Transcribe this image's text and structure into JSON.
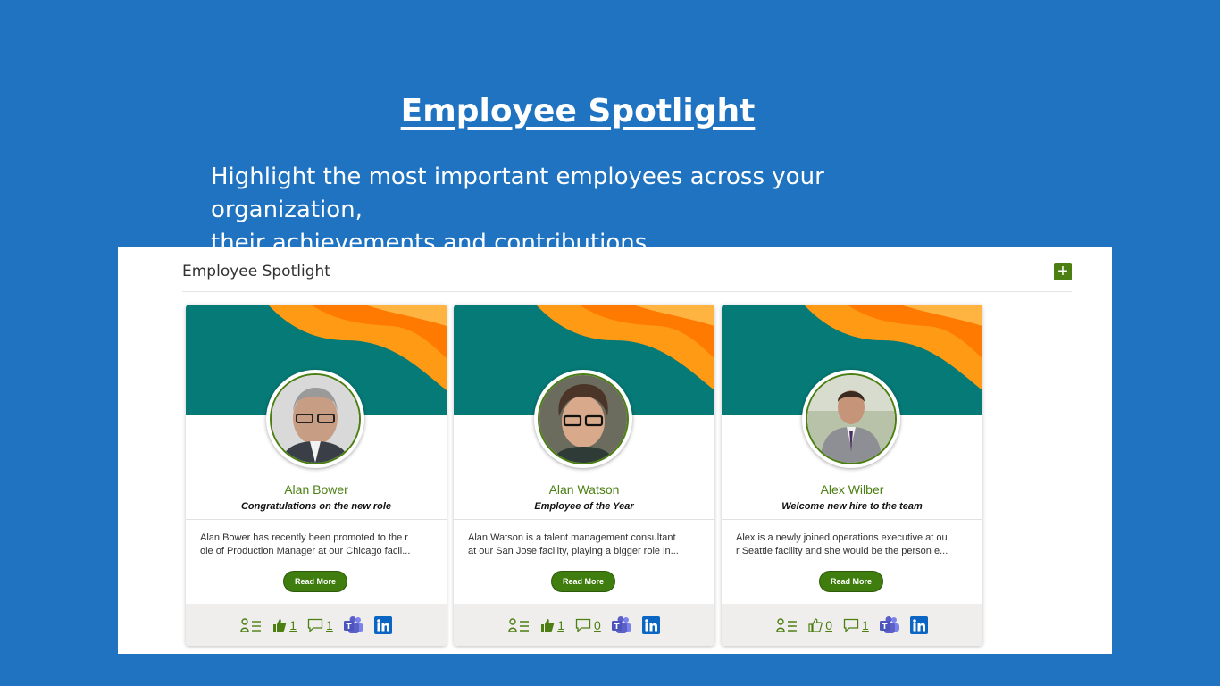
{
  "hero": {
    "title": "Employee Spotlight",
    "subtitle_line1": "Highlight the most important employees across your organization,",
    "subtitle_line2": "their achievements and contributions."
  },
  "panel": {
    "title": "Employee Spotlight",
    "add_label": "+"
  },
  "colors": {
    "page_bg": "#1f73c0",
    "accent_green": "#4b7f12",
    "banner_teal": "#067a76",
    "banner_orange": "#ff8a00",
    "teams_purple": "#5b5fc7",
    "linkedin_blue": "#0a66c2"
  },
  "cards": [
    {
      "name": "Alan Bower",
      "subtitle": "Congratulations on the new role",
      "desc_line1": "Alan Bower has recently been promoted to the r",
      "desc_line2": "ole of Production Manager at our Chicago facil...",
      "button": "Read More",
      "likes": "1",
      "comments": "1",
      "liked": true
    },
    {
      "name": "Alan Watson",
      "subtitle": "Employee of the Year",
      "desc_line1": "Alan Watson is a talent management consultant",
      "desc_line2": "at our San Jose facility, playing a bigger role in...",
      "button": "Read More",
      "likes": "1",
      "comments": "0",
      "liked": true
    },
    {
      "name": "Alex Wilber",
      "subtitle": "Welcome new hire to the team",
      "desc_line1": "Alex is a newly joined operations executive at ou",
      "desc_line2": "r Seattle facility and she would be the person e...",
      "button": "Read More",
      "likes": "0",
      "comments": "1",
      "liked": false
    }
  ],
  "icons": {
    "profile": "profile-list-icon",
    "like": "thumbs-up-icon",
    "comment": "comment-icon",
    "teams": "teams-icon",
    "linkedin": "linkedin-icon"
  }
}
